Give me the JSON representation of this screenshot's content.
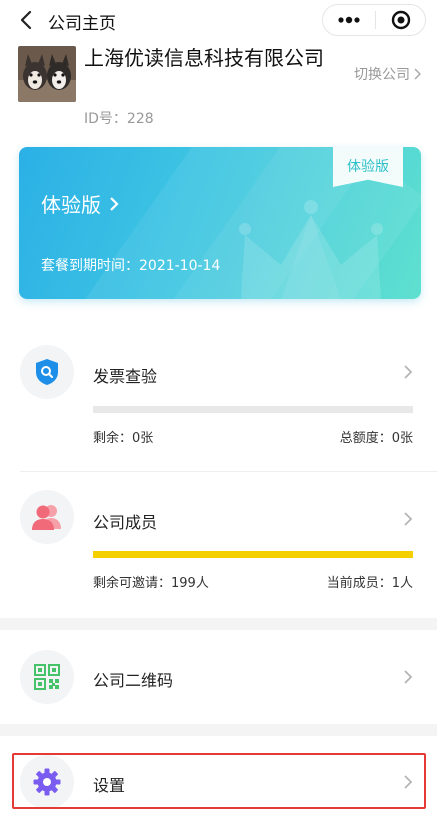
{
  "navbar": {
    "title": "公司主页"
  },
  "company": {
    "name": "上海优读信息科技有限公司",
    "id_text": "ID号：228",
    "switch_label": "切换公司"
  },
  "trial": {
    "badge": "体验版",
    "title": "体验版",
    "expire_text": "套餐到期时间：2021-10-14"
  },
  "invoice": {
    "label": "发票查验",
    "remaining": "剩余：0张",
    "total": "总额度：0张",
    "progress": 0
  },
  "members": {
    "label": "公司成员",
    "remaining": "剩余可邀请：199人",
    "current": "当前成员：1人",
    "progress": 1.0
  },
  "qrcode": {
    "label": "公司二维码"
  },
  "settings": {
    "label": "设置"
  },
  "colors": {
    "accent_blue": "#2bb0e6",
    "accent_teal": "#5fe0cf",
    "progress_yellow": "#f5d000",
    "highlight_red": "#e53935",
    "shield_blue": "#1e8fe8",
    "members_pink": "#f06a7a",
    "qr_green": "#46c26a",
    "settings_purple": "#7a5cf0"
  }
}
